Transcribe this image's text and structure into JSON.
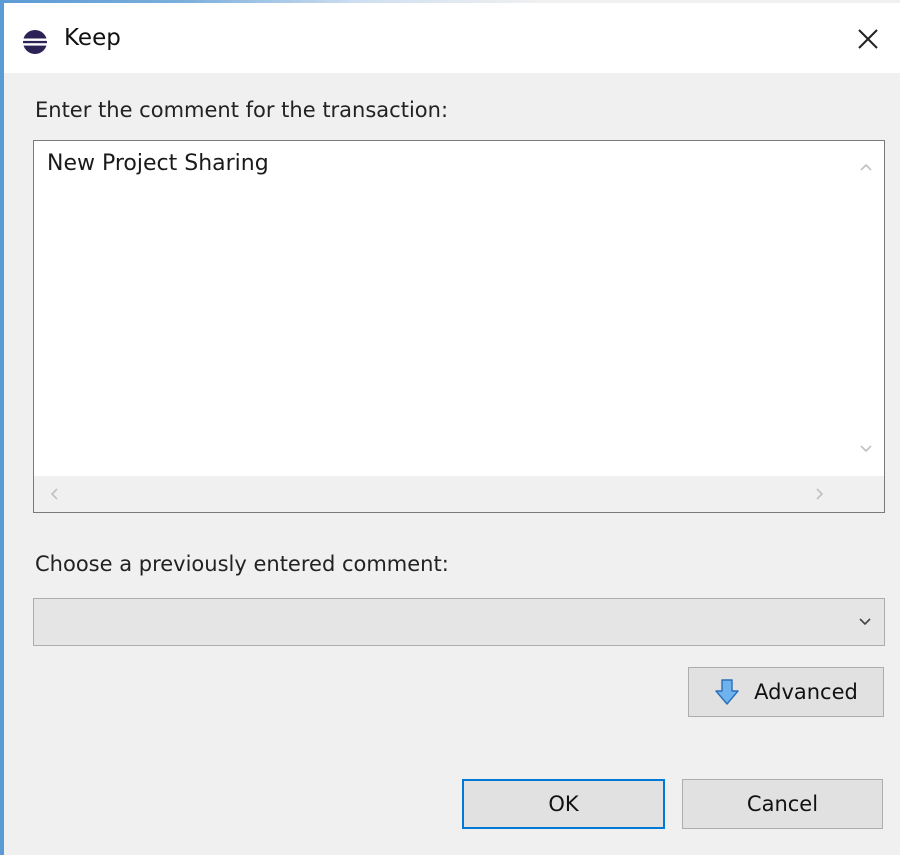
{
  "window": {
    "title": "Keep",
    "app_icon": "eclipse-icon",
    "close_icon": "close-icon"
  },
  "comment_section": {
    "label": "Enter the comment for the transaction:",
    "value": "New Project Sharing"
  },
  "previous_section": {
    "label": "Choose a previously entered comment:",
    "selected": ""
  },
  "buttons": {
    "advanced_label": "Advanced",
    "advanced_icon": "down-arrow-icon",
    "ok_label": "OK",
    "cancel_label": "Cancel"
  },
  "colors": {
    "accent": "#0078d7",
    "window_edge": "#5b9bd5",
    "background": "#f0f0f0"
  }
}
